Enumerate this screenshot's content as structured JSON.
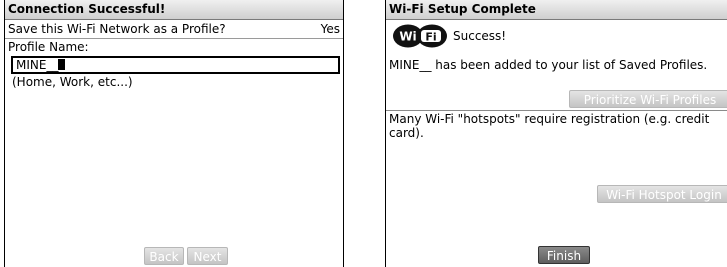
{
  "left": {
    "title": "Connection Successful!",
    "question": "Save this Wi-Fi Network as a Profile?",
    "question_value": "Yes",
    "profile_label": "Profile Name:",
    "profile_value": "MINE__",
    "profile_hint": "(Home, Work, etc...)",
    "back_label": "Back",
    "next_label": "Next"
  },
  "right": {
    "title": "Wi-Fi Setup Complete",
    "logo_text_1": "Wi",
    "logo_text_2": "Fi",
    "success_text": "Success!",
    "saved_message": "MINE__ has been added to your list of Saved Profiles.",
    "prioritize_label": "Prioritize Wi-Fi Profiles",
    "hotspot_message": "Many Wi-Fi \"hotspots\" require registration (e.g. credit card).",
    "hotspot_login_label": "Wi-Fi Hotspot Login",
    "finish_label": "Finish"
  }
}
